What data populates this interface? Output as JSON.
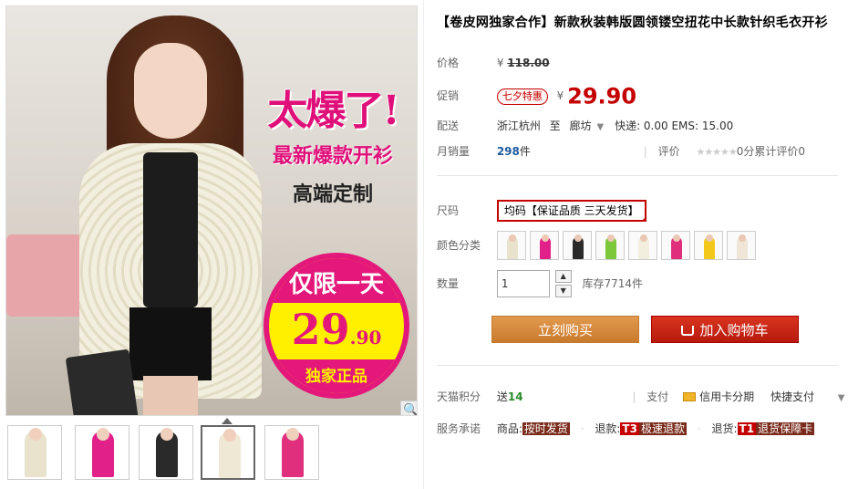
{
  "gallery": {
    "promo_line1": "太爆了!",
    "promo_line2": "最新爆款开衫",
    "promo_line3": "高端定制",
    "badge_top": "仅限一天",
    "badge_price_int": "29",
    "badge_price_dec": ".90",
    "badge_bottom": "独家正品",
    "zoom_icon": "magnifier-icon",
    "thumbs": [
      {
        "color": "#e9e2cc"
      },
      {
        "color": "#e2208a"
      },
      {
        "color": "#2a2a2a"
      },
      {
        "color": "#efe8d4"
      },
      {
        "color": "#e0307d"
      }
    ]
  },
  "product": {
    "title": "【卷皮网独家合作】新款秋装韩版圆领镂空扭花中长款针织毛衣开衫",
    "price_label": "价格",
    "yen": "¥",
    "original_price": "118.00",
    "promo_label": "促销",
    "promo_tag": "七夕特惠",
    "promo_price": "29.90",
    "shipping_label": "配送",
    "ship_from": "浙江杭州",
    "ship_to_word": "至",
    "ship_to": "廊坊",
    "ship_fees": "快递: 0.00 EMS: 15.00",
    "sales_label": "月销量",
    "sales_count": "298",
    "sales_unit": "件",
    "review_label": "评价",
    "stars": "★★★★★",
    "review_text": "0分累计评价0",
    "size_label": "尺码",
    "size_value": "均码【保证品质 三天发货】",
    "color_label": "颜色分类",
    "swatches": [
      "#e9e2cc",
      "#e2208a",
      "#2a2a2a",
      "#7cc83a",
      "#f2efde",
      "#e0307d",
      "#f4c81a",
      "#f0e6d8"
    ],
    "qty_label": "数量",
    "qty_value": "1",
    "stock": "库存7714件",
    "buy_now": "立刻购买",
    "add_cart": "加入购物车",
    "points_label": "天猫积分",
    "points_prefix": "送",
    "points_value": "14",
    "pay_label": "支付",
    "pay_credit": "信用卡分期",
    "pay_quick": "快捷支付",
    "service_label": "服务承诺",
    "svc_goods": "商品:",
    "svc_goods_tag": "按时发货",
    "svc_refund": "退款:",
    "svc_refund_badge": "T3",
    "svc_refund_tag": "极速退款",
    "svc_return": "退货:",
    "svc_return_badge": "T1",
    "svc_return_tag": "退货保障卡"
  }
}
